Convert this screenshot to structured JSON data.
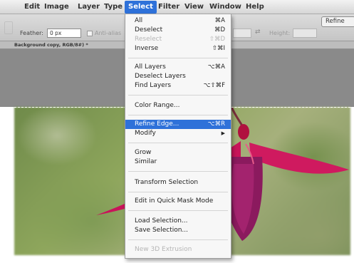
{
  "menubar": {
    "items": [
      {
        "label": "Edit"
      },
      {
        "label": "Image"
      },
      {
        "label": "Layer"
      },
      {
        "label": "Type"
      },
      {
        "label": "Select"
      },
      {
        "label": "Filter"
      },
      {
        "label": "View"
      },
      {
        "label": "Window"
      },
      {
        "label": "Help"
      }
    ],
    "active_item": "Select"
  },
  "options_bar": {
    "feather_label": "Feather:",
    "feather_value": "0 px",
    "anti_alias_label": "Anti-alias",
    "height_label": "Height:",
    "refine_button_label": "Refine"
  },
  "document_tab": {
    "label": "Background copy, RGB/8#) *"
  },
  "select_menu": {
    "items": [
      {
        "label": "All",
        "shortcut": "⌘A",
        "enabled": true
      },
      {
        "label": "Deselect",
        "shortcut": "⌘D",
        "enabled": true
      },
      {
        "label": "Reselect",
        "shortcut": "⇧⌘D",
        "enabled": false
      },
      {
        "label": "Inverse",
        "shortcut": "⇧⌘I",
        "enabled": true
      },
      {
        "label": "All Layers",
        "shortcut": "⌥⌘A",
        "enabled": true
      },
      {
        "label": "Deselect Layers",
        "shortcut": "",
        "enabled": true
      },
      {
        "label": "Find Layers",
        "shortcut": "⌥⇧⌘F",
        "enabled": true
      },
      {
        "label": "Color Range...",
        "shortcut": "",
        "enabled": true
      },
      {
        "label": "Refine Edge...",
        "shortcut": "⌥⌘R",
        "enabled": true,
        "highlighted": true
      },
      {
        "label": "Modify",
        "shortcut": "",
        "enabled": true,
        "submenu": true
      },
      {
        "label": "Grow",
        "shortcut": "",
        "enabled": true
      },
      {
        "label": "Similar",
        "shortcut": "",
        "enabled": true
      },
      {
        "label": "Transform Selection",
        "shortcut": "",
        "enabled": true
      },
      {
        "label": "Edit in Quick Mask Mode",
        "shortcut": "",
        "enabled": true
      },
      {
        "label": "Load Selection...",
        "shortcut": "",
        "enabled": true
      },
      {
        "label": "Save Selection...",
        "shortcut": "",
        "enabled": true
      },
      {
        "label": "New 3D Extrusion",
        "shortcut": "",
        "enabled": false
      }
    ]
  },
  "colors": {
    "menu_highlight": "#2e71d9",
    "flower_magenta": "#c8145a"
  },
  "icons": {
    "submenu_arrow": "chevron-right-icon",
    "swap": "swap-arrows-icon"
  }
}
